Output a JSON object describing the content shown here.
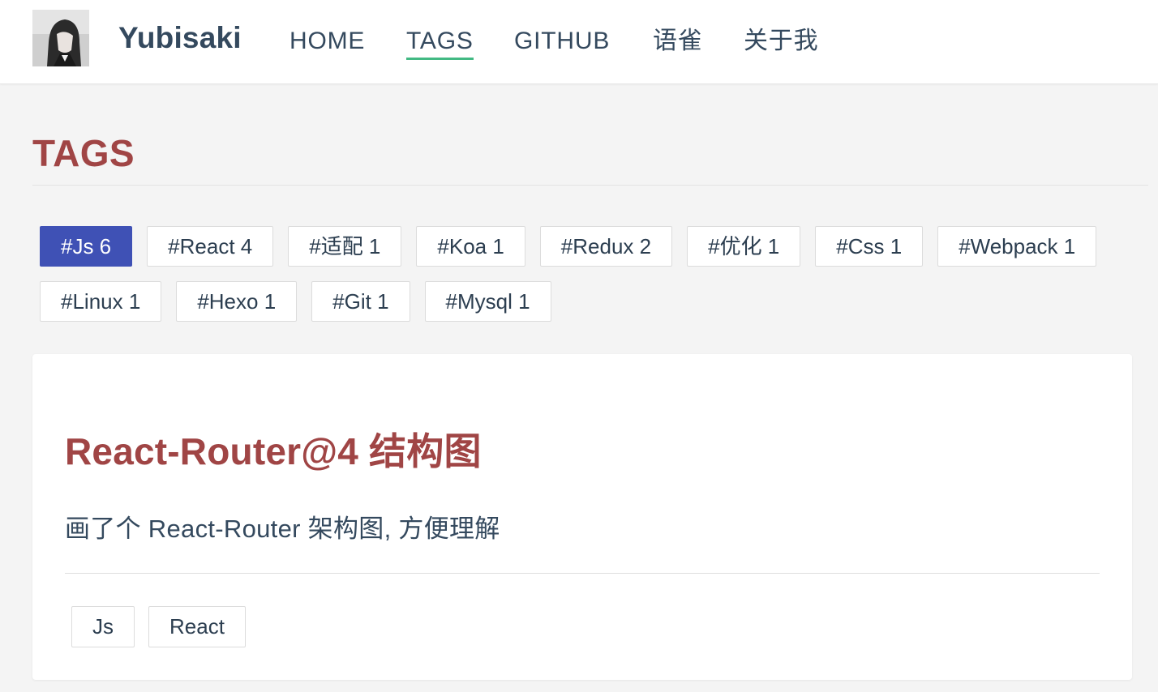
{
  "header": {
    "site_name": "Yubisaki",
    "nav": [
      {
        "label": "HOME",
        "active": false
      },
      {
        "label": "TAGS",
        "active": true
      },
      {
        "label": "GITHUB",
        "active": false
      },
      {
        "label": "语雀",
        "active": false
      },
      {
        "label": "关于我",
        "active": false
      }
    ]
  },
  "page": {
    "title": "TAGS"
  },
  "tags": [
    {
      "label": "#Js 6",
      "active": true
    },
    {
      "label": "#React 4",
      "active": false
    },
    {
      "label": "#适配 1",
      "active": false
    },
    {
      "label": "#Koa 1",
      "active": false
    },
    {
      "label": "#Redux 2",
      "active": false
    },
    {
      "label": "#优化 1",
      "active": false
    },
    {
      "label": "#Css 1",
      "active": false
    },
    {
      "label": "#Webpack 1",
      "active": false
    },
    {
      "label": "#Linux 1",
      "active": false
    },
    {
      "label": "#Hexo 1",
      "active": false
    },
    {
      "label": "#Git 1",
      "active": false
    },
    {
      "label": "#Mysql 1",
      "active": false
    }
  ],
  "post": {
    "title": "React-Router@4 结构图",
    "excerpt": "画了个 React-Router 架构图, 方便理解",
    "tags": [
      "Js",
      "React"
    ]
  },
  "colors": {
    "accent_title": "#a04545",
    "nav_active_underline": "#42b983",
    "active_tag_bg": "#3f51b5",
    "text": "#2c3e50"
  }
}
